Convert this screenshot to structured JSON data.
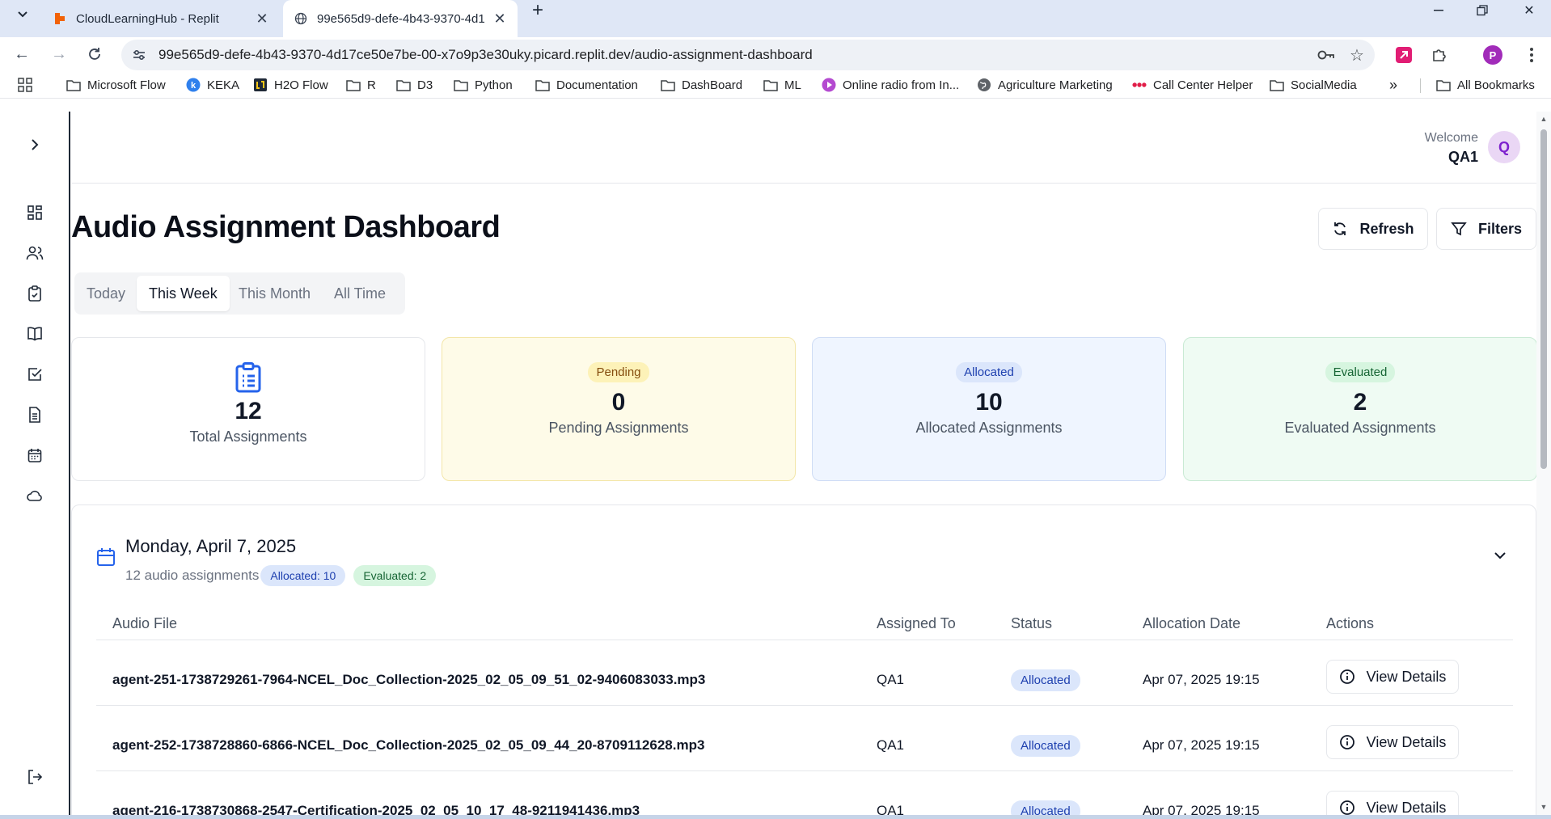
{
  "browser": {
    "tabs": [
      {
        "title": "CloudLearningHub - Replit",
        "active": false
      },
      {
        "title": "99e565d9-defe-4b43-9370-4d1",
        "active": true
      }
    ],
    "url": "99e565d9-defe-4b43-9370-4d17ce50e7be-00-x7o9p3e30uky.picard.replit.dev/audio-assignment-dashboard",
    "profile_initial": "P",
    "bookmarks": [
      {
        "label": "Microsoft Flow",
        "icon": "folder-icon"
      },
      {
        "label": "KEKA",
        "icon": "keka-icon"
      },
      {
        "label": "H2O Flow",
        "icon": "h2o-icon"
      },
      {
        "label": "R",
        "icon": "folder-icon"
      },
      {
        "label": "D3",
        "icon": "folder-icon"
      },
      {
        "label": "Python",
        "icon": "folder-icon"
      },
      {
        "label": "Documentation",
        "icon": "folder-icon"
      },
      {
        "label": "DashBoard",
        "icon": "folder-icon"
      },
      {
        "label": "ML",
        "icon": "folder-icon"
      },
      {
        "label": "Online radio from In...",
        "icon": "radio-icon"
      },
      {
        "label": "Agriculture Marketing",
        "icon": "globe-icon"
      },
      {
        "label": "Call Center Helper",
        "icon": "dots-icon"
      },
      {
        "label": "SocialMedia",
        "icon": "folder-icon"
      }
    ],
    "more_bookmarks": "»",
    "all_bookmarks": "All Bookmarks"
  },
  "header": {
    "welcome_label": "Welcome",
    "user_name": "QA1",
    "avatar_initial": "Q"
  },
  "page": {
    "title": "Audio Assignment Dashboard",
    "refresh_label": "Refresh",
    "filters_label": "Filters"
  },
  "range_tabs": [
    {
      "label": "Today",
      "selected": false
    },
    {
      "label": "This Week",
      "selected": true
    },
    {
      "label": "This Month",
      "selected": false
    },
    {
      "label": "All Time",
      "selected": false
    }
  ],
  "stats": {
    "total": {
      "value": "12",
      "label": "Total Assignments"
    },
    "pending": {
      "badge": "Pending",
      "value": "0",
      "label": "Pending Assignments"
    },
    "allocated": {
      "badge": "Allocated",
      "value": "10",
      "label": "Allocated Assignments"
    },
    "evaluated": {
      "badge": "Evaluated",
      "value": "2",
      "label": "Evaluated Assignments"
    }
  },
  "day_group": {
    "date": "Monday, April 7, 2025",
    "count_text": "12 audio assignments",
    "allocated_pill": "Allocated: 10",
    "evaluated_pill": "Evaluated: 2"
  },
  "table": {
    "columns": [
      "Audio File",
      "Assigned To",
      "Status",
      "Allocation Date",
      "Actions"
    ],
    "rows": [
      {
        "file": "agent-251-1738729261-7964-NCEL_Doc_Collection-2025_02_05_09_51_02-9406083033.mp3",
        "assigned_to": "QA1",
        "status": "Allocated",
        "date": "Apr 07, 2025 19:15",
        "action": "View Details"
      },
      {
        "file": "agent-252-1738728860-6866-NCEL_Doc_Collection-2025_02_05_09_44_20-8709112628.mp3",
        "assigned_to": "QA1",
        "status": "Allocated",
        "date": "Apr 07, 2025 19:15",
        "action": "View Details"
      },
      {
        "file": "agent-216-1738730868-2547-Certification-2025_02_05_10_17_48-9211941436.mp3",
        "assigned_to": "QA1",
        "status": "Allocated",
        "date": "Apr 07, 2025 19:15",
        "action": "View Details"
      }
    ]
  },
  "colors": {
    "accent_blue": "#2563eb",
    "pending_bg": "#fefbe8",
    "allocated_bg": "#eff5ff",
    "evaluated_bg": "#effbf3"
  }
}
